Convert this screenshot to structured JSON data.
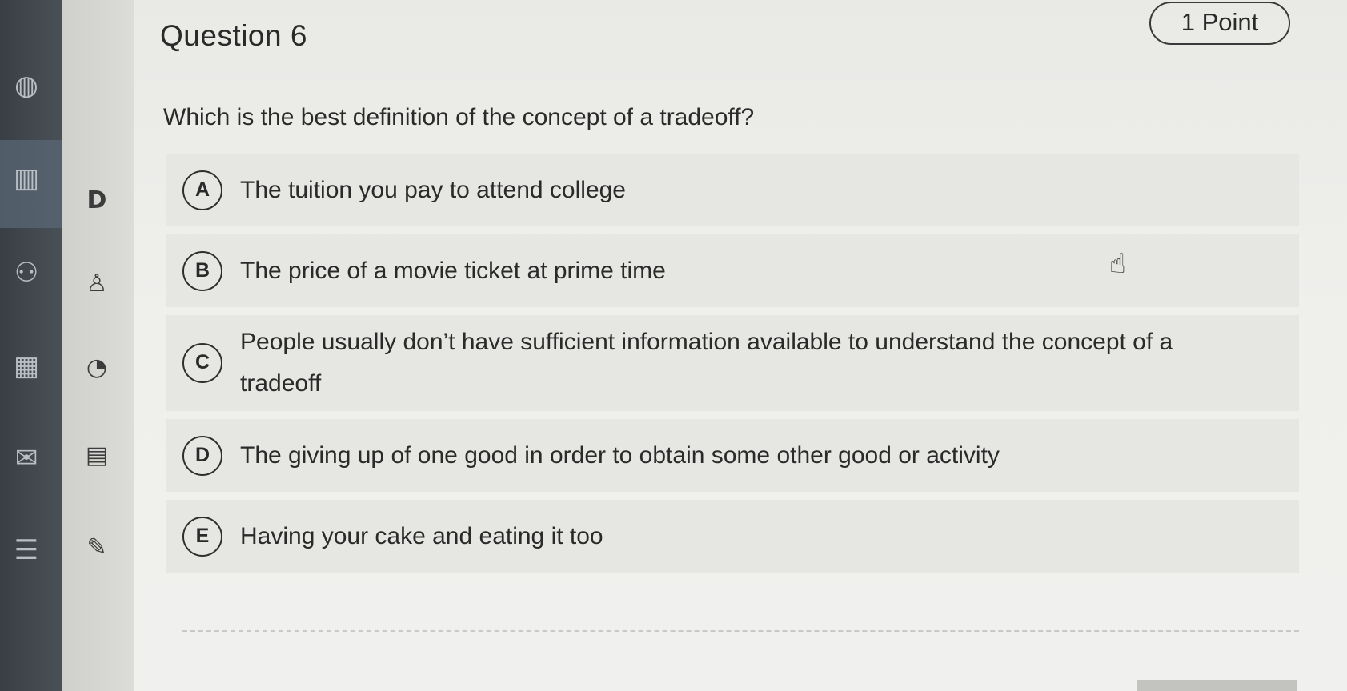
{
  "question": {
    "title": "Question 6",
    "points": "1 Point",
    "prompt": "Which is the best definition of the concept of a tradeoff?"
  },
  "options": [
    {
      "letter": "A",
      "text": "The tuition you pay to attend college"
    },
    {
      "letter": "B",
      "text": "The price of a movie ticket at prime time"
    },
    {
      "letter": "C",
      "text": "People usually don’t have sufficient information available to understand the concept of a tradeoff"
    },
    {
      "letter": "D",
      "text": "The giving up of one good in order to obtain some other good or activity"
    },
    {
      "letter": "E",
      "text": "Having your cake and eating it too"
    }
  ],
  "sidebar": {
    "icons": [
      "globe-icon",
      "book-icon",
      "people-icon",
      "calendar-icon",
      "mail-icon",
      "document-icon"
    ]
  },
  "sub_panel": {
    "letter": "D"
  }
}
